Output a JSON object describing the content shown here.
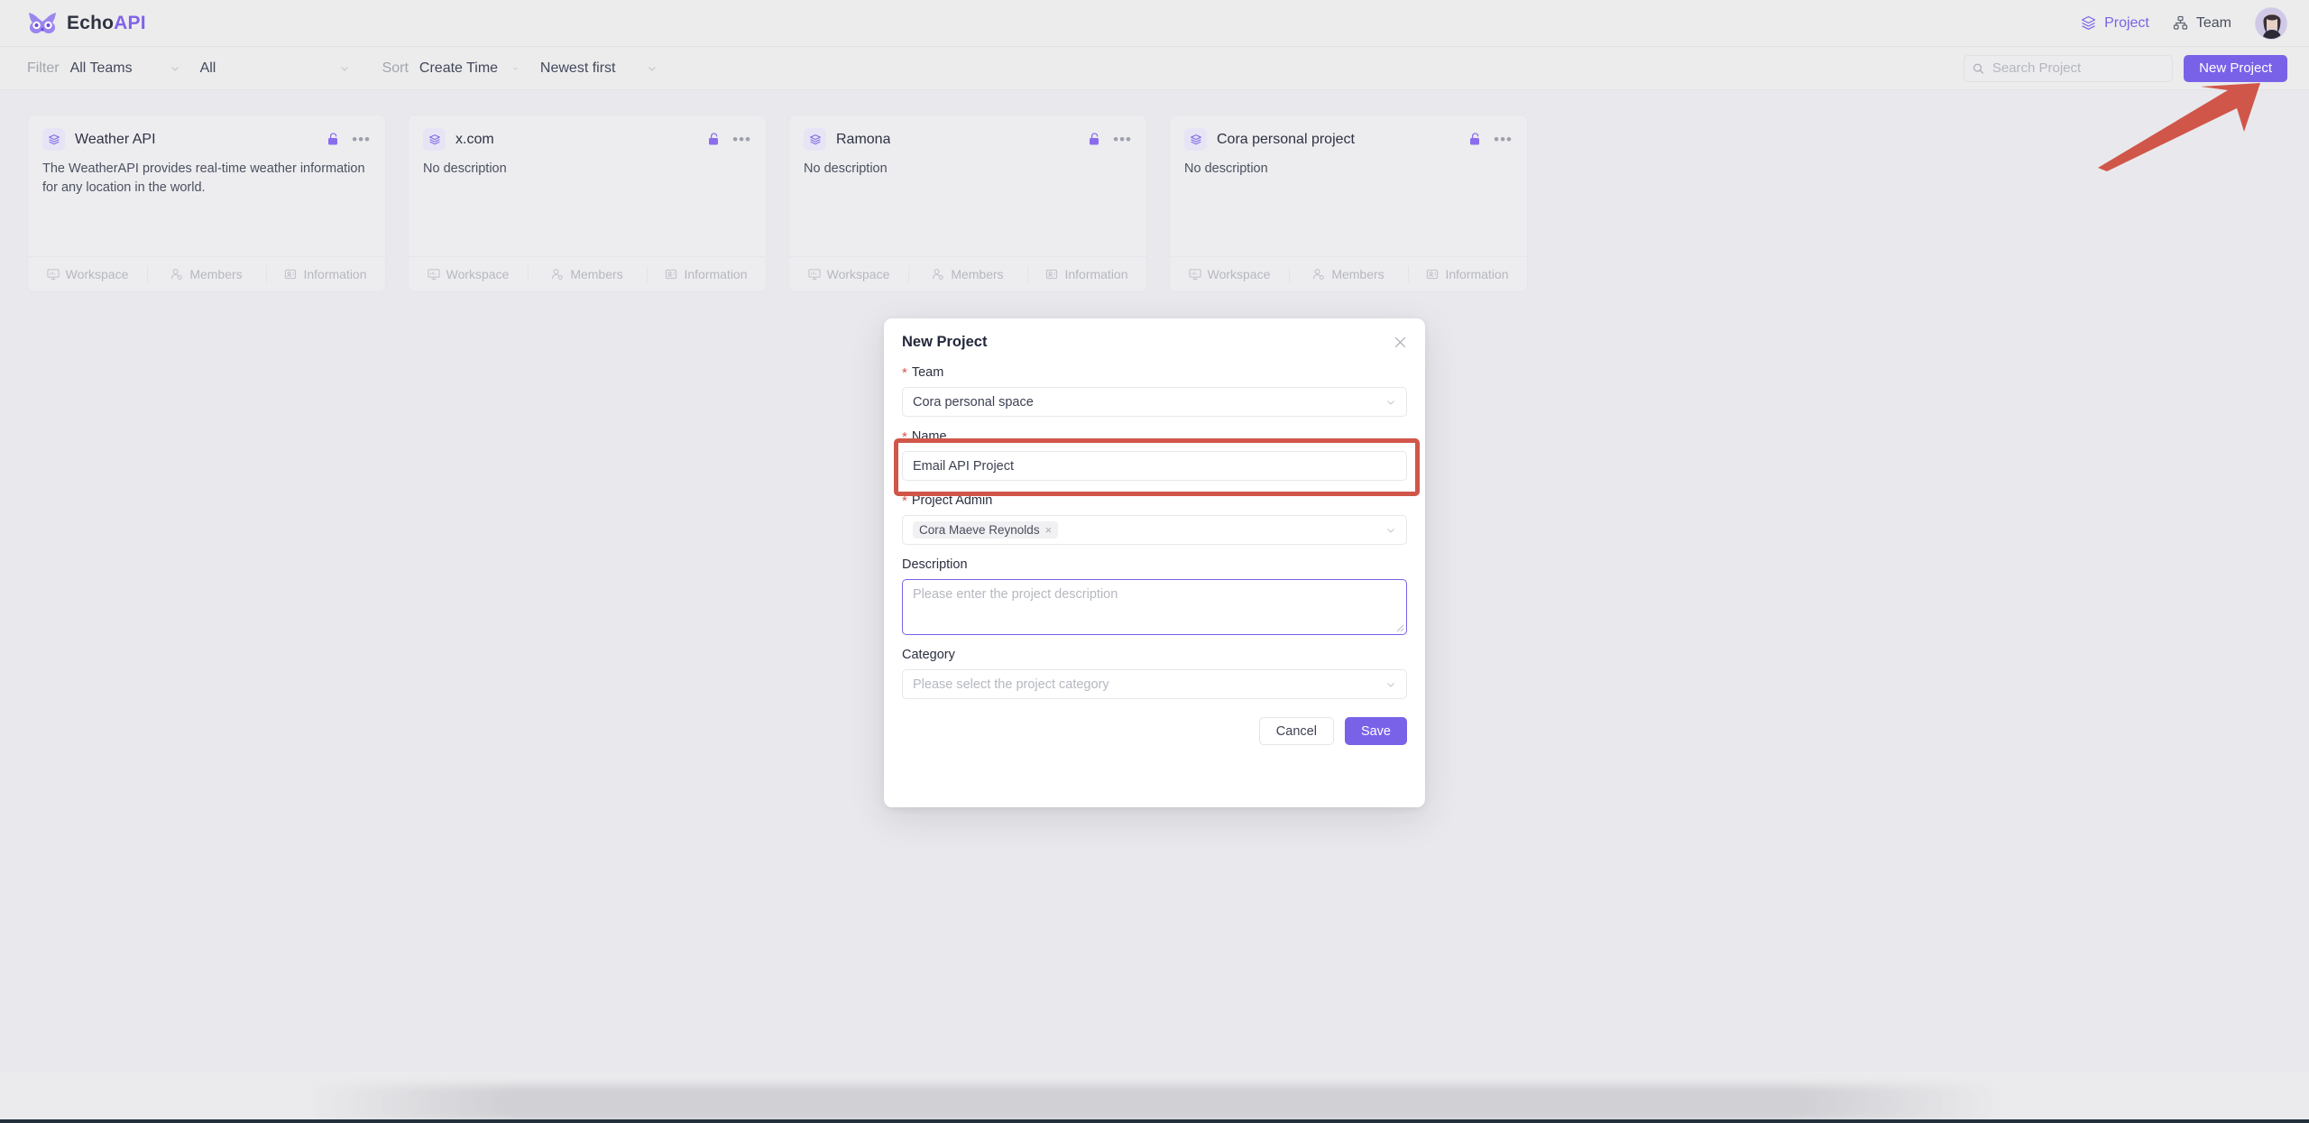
{
  "brand": {
    "name_dark": "Echo",
    "name_accent": "API"
  },
  "topnav": [
    {
      "label": "Project",
      "icon": "layers-icon",
      "active": true
    },
    {
      "label": "Team",
      "icon": "org-chart-icon",
      "active": false
    }
  ],
  "filterbar": {
    "filter_label": "Filter",
    "team_filter": "All Teams",
    "type_filter": "All",
    "sort_label": "Sort",
    "sort_field": "Create Time",
    "sort_order": "Newest first",
    "search_placeholder": "Search Project",
    "search_value": "",
    "new_project_label": "New Project"
  },
  "cards": [
    {
      "title": "Weather API",
      "description": "The WeatherAPI provides real-time weather information for any location in the world.",
      "lock": "unlock-icon",
      "footer": [
        "Workspace",
        "Members",
        "Information"
      ]
    },
    {
      "title": "x.com",
      "description": "No description",
      "lock": "unlock-icon",
      "footer": [
        "Workspace",
        "Members",
        "Information"
      ]
    },
    {
      "title": "Ramona",
      "description": "No description",
      "lock": "unlock-icon",
      "footer": [
        "Workspace",
        "Members",
        "Information"
      ]
    },
    {
      "title": "Cora personal project",
      "description": "No description",
      "lock": "unlock-icon",
      "footer": [
        "Workspace",
        "Members",
        "Information"
      ]
    }
  ],
  "modal": {
    "title": "New Project",
    "fields": {
      "team": {
        "label": "Team",
        "required_mark": "*",
        "value": "Cora personal space"
      },
      "name": {
        "label": "Name",
        "required_mark": "*",
        "value": "Email API Project"
      },
      "project_admin": {
        "label": "Project Admin",
        "required_mark": "*",
        "chip": "Cora Maeve Reynolds",
        "chip_remove": "×"
      },
      "description": {
        "label": "Description",
        "placeholder": "Please enter the project description",
        "value": ""
      },
      "category": {
        "label": "Category",
        "placeholder": "Please select the project category",
        "value": ""
      }
    },
    "cancel_label": "Cancel",
    "save_label": "Save"
  },
  "colors": {
    "accent_purple": "#7a62e8",
    "annotation_red": "#d0564a",
    "page_bg": "#e9e9ed",
    "card_bg": "#ededf0",
    "required_red": "#d9534f"
  }
}
